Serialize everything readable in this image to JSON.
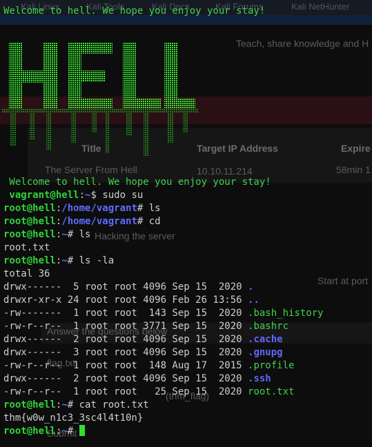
{
  "background_page": {
    "tabs": [
      "Kali Linux",
      "Kali Tools",
      "Kali Docs",
      "Kali Forums",
      "Kali NetHunter"
    ],
    "tagline": "Teach, share knowledge and H",
    "table_headers": [
      "Title",
      "Target IP Address",
      "Expire"
    ],
    "room_title": "The Server From Hell",
    "target_ip": "10.10.11.214",
    "expire": "58min 1",
    "task_title": "Hacking the server",
    "start_at_port": "Start at port",
    "answer_heading": "Answer the questions below",
    "file_hint": "flag.txt",
    "hint_example": "(thm_flag)",
    "submit": "Submit"
  },
  "terminal": {
    "welcome_top": "Welcome to hell. We hope you enjoy your stay!",
    "banner_word": "HELL",
    "welcome": " Welcome to hell. We hope you enjoy your stay!",
    "vagrant_prompt": {
      "user": " vagrant@hell",
      "path": "~",
      "symbol": "$ ",
      "cmd": "sudo su"
    },
    "root_user": "root@hell",
    "commands": [
      {
        "path": "/home/vagrant",
        "symbol": "# ",
        "cmd": "ls"
      },
      {
        "path": "/home/vagrant",
        "symbol": "# ",
        "cmd": "cd"
      },
      {
        "path": "~",
        "symbol": "# ",
        "cmd": "ls"
      }
    ],
    "ls_output": "root.txt",
    "ls_la_cmd": {
      "path": "~",
      "symbol": "# ",
      "cmd": "ls -la"
    },
    "total": "total 36",
    "listing": [
      {
        "meta": "drwx------  5 root root 4096 Sep 15  2020 ",
        "name": ".",
        "dir": true
      },
      {
        "meta": "drwxr-xr-x 24 root root 4096 Feb 26 13:56 ",
        "name": "..",
        "dir": true
      },
      {
        "meta": "-rw-------  1 root root  143 Sep 15  2020 ",
        "name": ".bash_history",
        "dir": false
      },
      {
        "meta": "-rw-r--r--  1 root root 3771 Sep 15  2020 ",
        "name": ".bashrc",
        "dir": false
      },
      {
        "meta": "drwx------  2 root root 4096 Sep 15  2020 ",
        "name": ".cache",
        "dir": true
      },
      {
        "meta": "drwx------  3 root root 4096 Sep 15  2020 ",
        "name": ".gnupg",
        "dir": true
      },
      {
        "meta": "-rw-r--r--  1 root root  148 Aug 17  2015 ",
        "name": ".profile",
        "dir": false
      },
      {
        "meta": "drwx------  2 root root 4096 Sep 15  2020 ",
        "name": ".ssh",
        "dir": true
      },
      {
        "meta": "-rw-r--r--  1 root root   25 Sep 15  2020 ",
        "name": "root.txt",
        "dir": false
      }
    ],
    "cat_cmd": {
      "path": "~",
      "symbol": "# ",
      "cmd": "cat root.txt"
    },
    "flag": "thm{w0w_n1c3_3sc4l4t10n}",
    "final_prompt": {
      "path": "~",
      "symbol": "# "
    }
  },
  "colors": {
    "green": "#43d14e",
    "blue": "#5f6cff",
    "text": "#c9c9c9",
    "background": "#0d0d0d"
  }
}
